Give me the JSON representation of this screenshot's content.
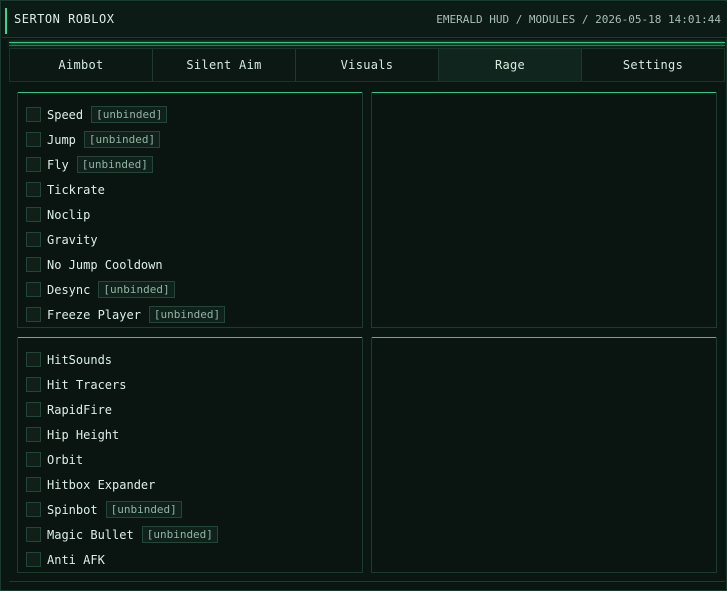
{
  "window": {
    "title": "SERTON ROBLOX",
    "status": "EMERALD HUD / MODULES / 2026-05-18 14:01:44"
  },
  "tabs": [
    {
      "label": "Aimbot"
    },
    {
      "label": "Silent Aim"
    },
    {
      "label": "Visuals"
    },
    {
      "label": "Rage",
      "active": true
    },
    {
      "label": "Settings"
    }
  ],
  "movement_panel": {
    "items": [
      {
        "label": "Speed",
        "keybind": "[unbinded]",
        "checked": false
      },
      {
        "label": "Jump",
        "keybind": "[unbinded]",
        "checked": false
      },
      {
        "label": "Fly",
        "keybind": "[unbinded]",
        "checked": false
      },
      {
        "label": "Tickrate",
        "checked": false
      },
      {
        "label": "Noclip",
        "checked": false
      },
      {
        "label": "Gravity",
        "checked": false
      },
      {
        "label": "No Jump Cooldown",
        "checked": false
      },
      {
        "label": "Desync",
        "keybind": "[unbinded]",
        "checked": false
      },
      {
        "label": "Freeze Player",
        "keybind": "[unbinded]",
        "checked": false
      }
    ]
  },
  "combat_panel": {
    "items": [
      {
        "label": "HitSounds",
        "checked": false
      },
      {
        "label": "Hit Tracers",
        "checked": false
      },
      {
        "label": "RapidFire",
        "checked": false
      },
      {
        "label": "Hip Height",
        "checked": false
      },
      {
        "label": "Orbit",
        "checked": false
      },
      {
        "label": "Hitbox Expander",
        "checked": false
      },
      {
        "label": "Spinbot",
        "keybind": "[unbinded]",
        "checked": false
      },
      {
        "label": "Magic Bullet",
        "keybind": "[unbinded]",
        "checked": false
      },
      {
        "label": "Anti AFK",
        "checked": false
      }
    ]
  },
  "colors": {
    "accent": "#36c987",
    "background": "#0a1612",
    "border": "#1f3b30"
  }
}
